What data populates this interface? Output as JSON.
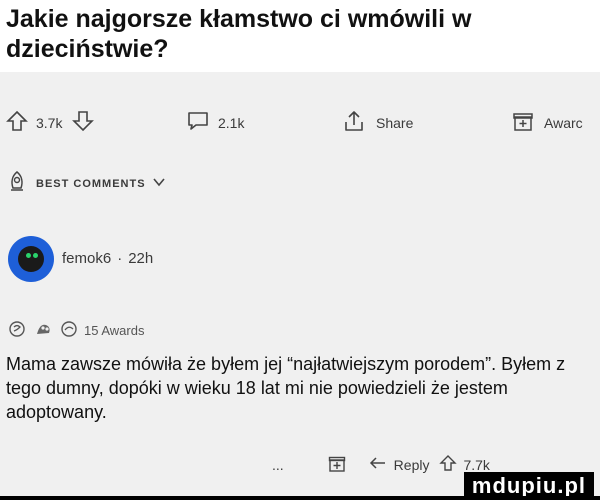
{
  "title": "Jakie najgorsze kłamstwo ci wmówili w dzieciństwie?",
  "actions": {
    "upvotes": "3.7k",
    "comments": "2.1k",
    "share": "Share",
    "award": "Awarc"
  },
  "best_comments": "BEST COMMENTS",
  "comment": {
    "username": "femok6",
    "separator": "·",
    "time": "22h",
    "awards_label": "15 Awards",
    "text": "Mama zawsze mówiła że byłem jej “najłatwiejszym porodem”. Byłem z tego dumny, dopóki w wieku 18 lat mi nie powiedzieli że jestem adoptowany.",
    "more": "...",
    "reply": "Reply",
    "votes": "7.7k"
  },
  "watermark": "mdupiu.pl",
  "colors": {
    "avatar": "#1e5fd8",
    "background": "#f0f0f0"
  }
}
